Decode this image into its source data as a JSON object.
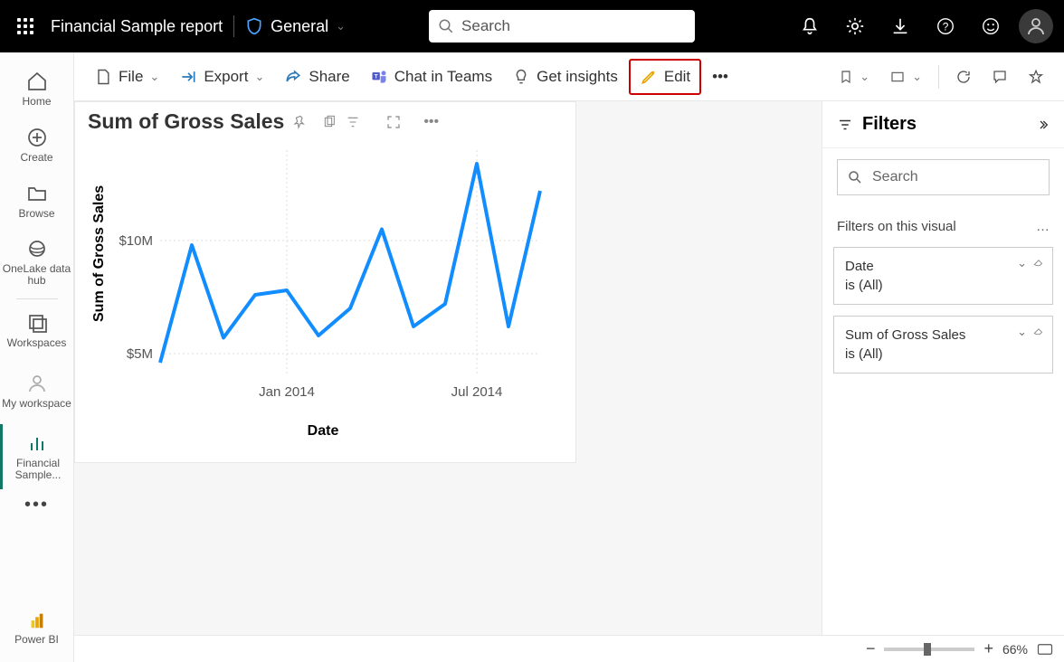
{
  "topbar": {
    "report_title": "Financial Sample report",
    "sensitivity_label": "General",
    "search_placeholder": "Search"
  },
  "leftnav": {
    "home": "Home",
    "create": "Create",
    "browse": "Browse",
    "onelake": "OneLake data hub",
    "workspaces": "Workspaces",
    "myworkspace": "My workspace",
    "active_report": "Financial Sample...",
    "footer": "Power BI"
  },
  "toolbar": {
    "file": "File",
    "export": "Export",
    "share": "Share",
    "chat": "Chat in Teams",
    "insights": "Get insights",
    "edit": "Edit"
  },
  "visual": {
    "title": "Sum of Gross Sales"
  },
  "chart_data": {
    "type": "line",
    "title": "Sum of Gross Sales",
    "xlabel": "Date",
    "ylabel": "Sum of Gross Sales",
    "y_ticks": [
      {
        "label": "$5M",
        "value": 5
      },
      {
        "label": "$10M",
        "value": 10
      }
    ],
    "x_tick_labels": [
      "Jan 2014",
      "Jul 2014"
    ],
    "series": [
      {
        "name": "Sum of Gross Sales",
        "values": [
          4.6,
          9.8,
          5.7,
          7.6,
          7.8,
          5.8,
          7.0,
          10.5,
          6.2,
          7.2,
          13.4,
          6.2,
          12.2
        ]
      }
    ],
    "color": "#118DFF"
  },
  "filters": {
    "title": "Filters",
    "search_placeholder": "Search",
    "section": "Filters on this visual",
    "cards": [
      {
        "field": "Date",
        "status": "is (All)"
      },
      {
        "field": "Sum of Gross Sales",
        "status": "is (All)"
      }
    ]
  },
  "statusbar": {
    "zoom": "66%"
  }
}
